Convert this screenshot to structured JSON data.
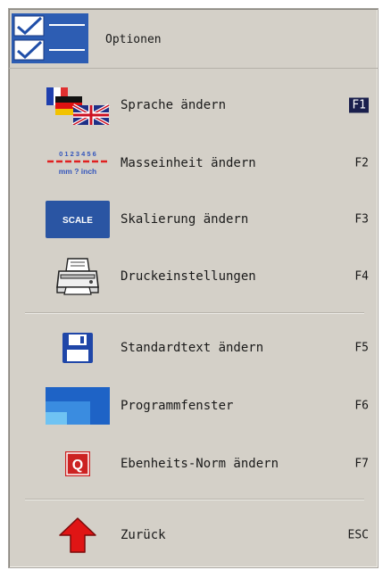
{
  "header": {
    "title": "Optionen",
    "icon": "checklist-icon"
  },
  "items": [
    {
      "label": "Sprache ändern",
      "key": "F1",
      "icon": "flags-icon"
    },
    {
      "label": "Masseinheit ändern",
      "key": "F2",
      "icon": "ruler-units-icon",
      "icon_text": {
        "numbers": "0 1 2 3 4 5 6",
        "units": "mm ? inch"
      }
    },
    {
      "label": "Skalierung ändern",
      "key": "F3",
      "icon": "scale-icon",
      "icon_text": {
        "badge": "SCALE"
      }
    },
    {
      "label": "Druckeinstellungen",
      "key": "F4",
      "icon": "printer-icon"
    },
    {
      "label": "Standardtext ändern",
      "key": "F5",
      "icon": "floppy-disk-icon"
    },
    {
      "label": "Programmfenster",
      "key": "F6",
      "icon": "program-window-icon"
    },
    {
      "label": "Ebenheits-Norm ändern",
      "key": "F7",
      "icon": "q-norm-icon",
      "icon_text": {
        "badge": "Q"
      }
    },
    {
      "label": "Zurück",
      "key": "ESC",
      "icon": "up-arrow-icon"
    }
  ],
  "colors": {
    "panel": "#d4d0c8",
    "accent": "#2a55a3",
    "selected_key_bg": "#1a1f4d",
    "back_arrow": "#e01515",
    "q_badge": "#cc2222"
  }
}
